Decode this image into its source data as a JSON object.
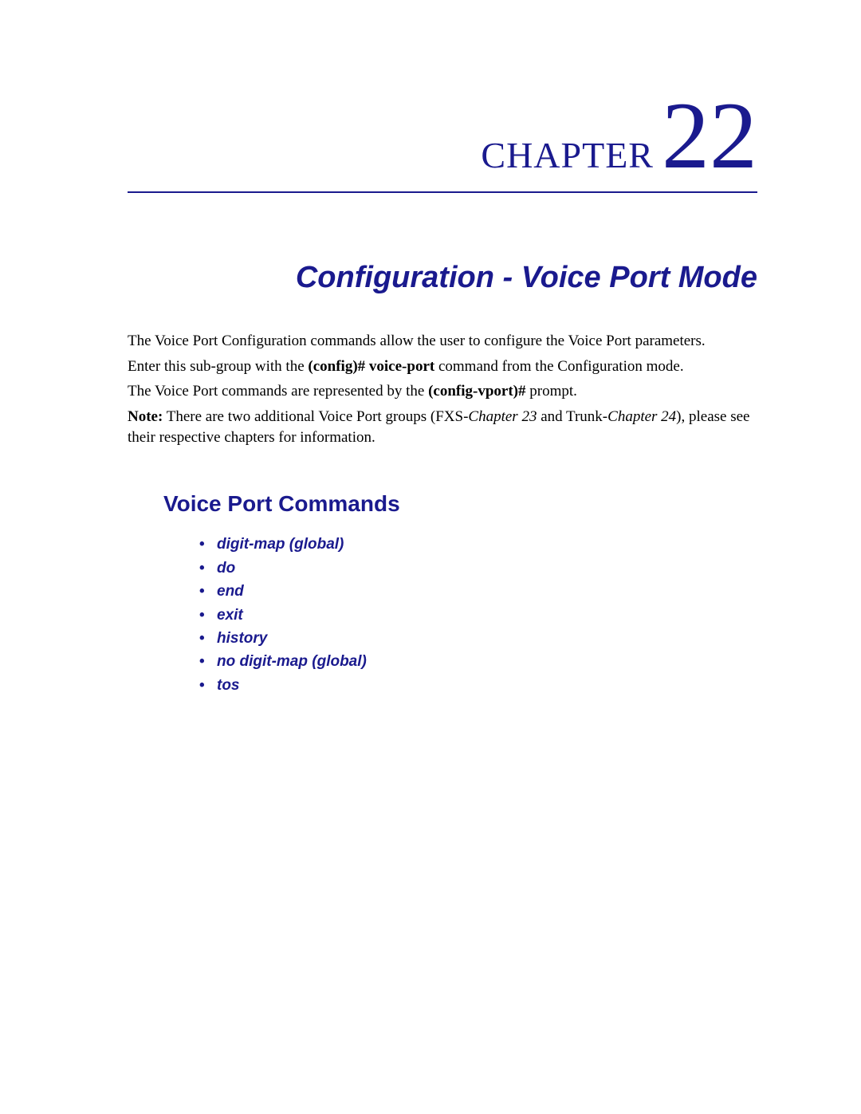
{
  "chapter": {
    "label": "CHAPTER",
    "number": "22",
    "title": "Configuration - Voice Port Mode"
  },
  "intro": {
    "p1": "The Voice Port Configuration commands allow the user to configure the Voice Port parameters.",
    "p2_pre": "Enter this sub-group with the ",
    "p2_bold": "(config)# voice-port",
    "p2_post": " command from the Configuration mode.",
    "p3_pre": "The Voice Port commands are represented by the ",
    "p3_bold": "(config-vport)#",
    "p3_post": " prompt.",
    "p4_note": "Note:",
    "p4_a": " There are two additional Voice Port groups (FXS-",
    "p4_italic1": "Chapter 23",
    "p4_b": " and Trunk-",
    "p4_italic2": "Chapter 24",
    "p4_c": "), please see their respective chapters for information."
  },
  "section": {
    "heading": "Voice Port Commands",
    "commands": [
      "digit-map (global)",
      "do",
      "end",
      "exit",
      "history",
      "no digit-map (global)",
      "tos"
    ]
  }
}
